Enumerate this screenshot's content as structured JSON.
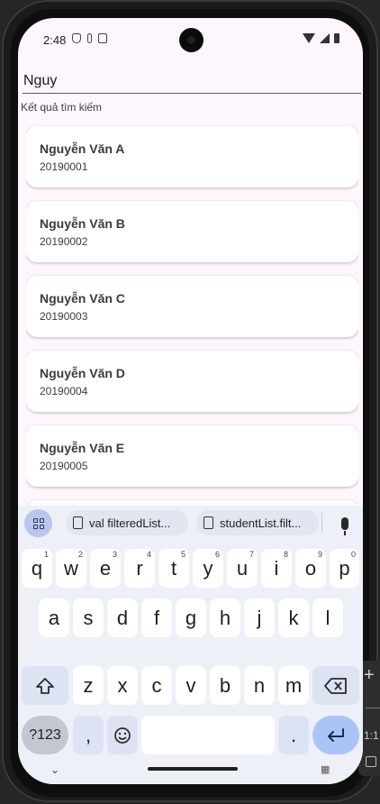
{
  "status_bar": {
    "time": "2:48",
    "left_icons": [
      "shield-icon",
      "mic-icon",
      "clipboard-icon"
    ],
    "right_icons": [
      "wifi-icon",
      "cell-signal-icon",
      "battery-icon"
    ]
  },
  "search": {
    "value": "Nguy",
    "results_label": "Kết quả tìm kiếm"
  },
  "results": [
    {
      "name": "Nguyễn Văn A",
      "id": "20190001"
    },
    {
      "name": "Nguyễn Văn B",
      "id": "20190002"
    },
    {
      "name": "Nguyễn Văn C",
      "id": "20190003"
    },
    {
      "name": "Nguyễn Văn D",
      "id": "20190004"
    },
    {
      "name": "Nguyễn Văn E",
      "id": "20190005"
    }
  ],
  "keyboard": {
    "suggestions": [
      "val filteredList...",
      "studentList.filt..."
    ],
    "row1": [
      "q",
      "w",
      "e",
      "r",
      "t",
      "y",
      "u",
      "i",
      "o",
      "p"
    ],
    "row1_hints": [
      "1",
      "2",
      "3",
      "4",
      "5",
      "6",
      "7",
      "8",
      "9",
      "0"
    ],
    "row2": [
      "a",
      "s",
      "d",
      "f",
      "g",
      "h",
      "j",
      "k",
      "l"
    ],
    "row3": [
      "z",
      "x",
      "c",
      "v",
      "b",
      "n",
      "m"
    ],
    "symbols_label": "?123",
    "comma": ",",
    "period": "."
  },
  "side_panel": {
    "plus": "+",
    "ratio": "1:1"
  },
  "colors": {
    "screen_bg": "#fdf6fc",
    "keyboard_bg": "#eef0f8",
    "enter_key": "#aac4f8",
    "apps_button": "#b9c7ee"
  }
}
